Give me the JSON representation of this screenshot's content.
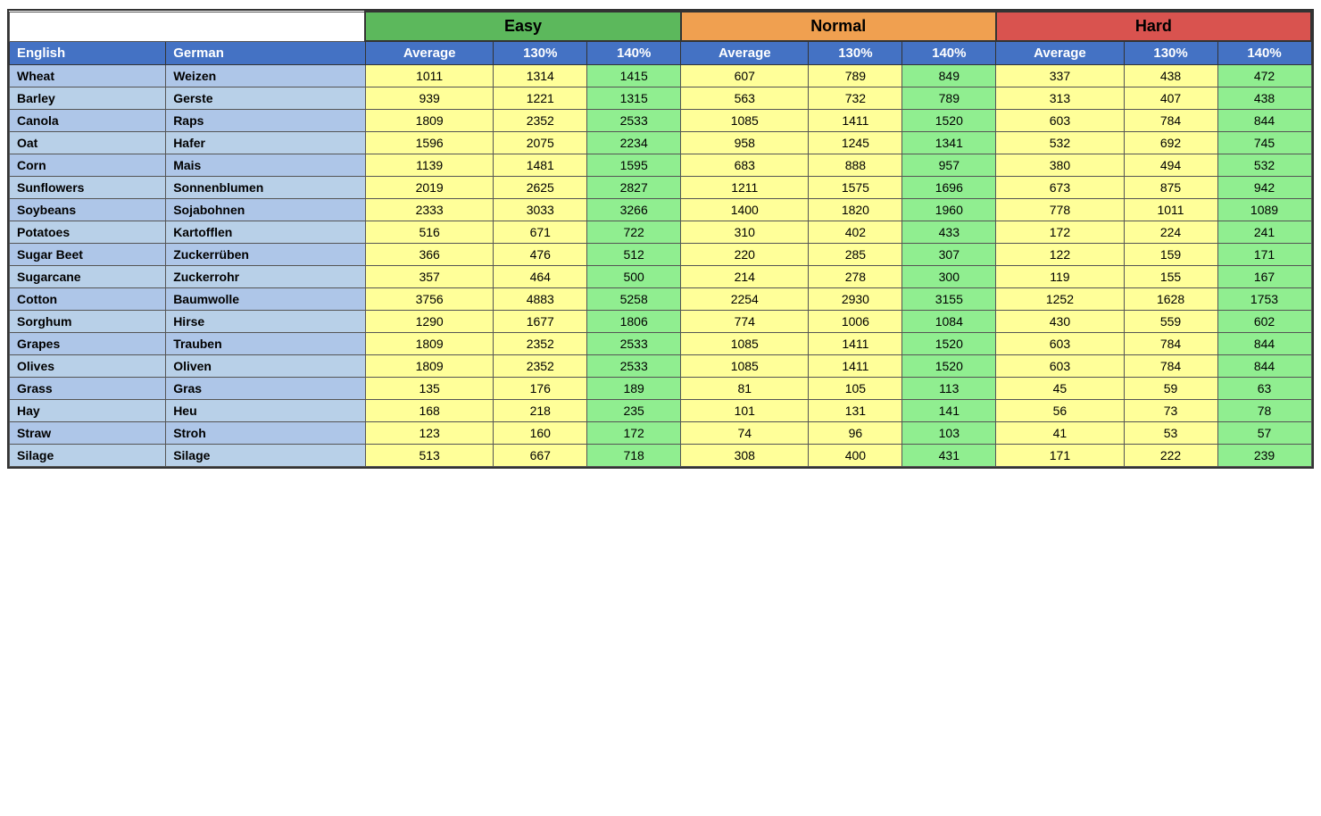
{
  "table": {
    "category_headers": {
      "easy": "Easy",
      "normal": "Normal",
      "hard": "Hard"
    },
    "col_headers": {
      "english": "English",
      "german": "German",
      "average": "Average",
      "p130": "130%",
      "p140": "140%"
    },
    "rows": [
      {
        "english": "Wheat",
        "german": "Weizen",
        "e_avg": 1011,
        "e_130": 1314,
        "e_140": 1415,
        "n_avg": 607,
        "n_130": 789,
        "n_140": 849,
        "h_avg": 337,
        "h_130": 438,
        "h_140": 472
      },
      {
        "english": "Barley",
        "german": "Gerste",
        "e_avg": 939,
        "e_130": 1221,
        "e_140": 1315,
        "n_avg": 563,
        "n_130": 732,
        "n_140": 789,
        "h_avg": 313,
        "h_130": 407,
        "h_140": 438
      },
      {
        "english": "Canola",
        "german": "Raps",
        "e_avg": 1809,
        "e_130": 2352,
        "e_140": 2533,
        "n_avg": 1085,
        "n_130": 1411,
        "n_140": 1520,
        "h_avg": 603,
        "h_130": 784,
        "h_140": 844
      },
      {
        "english": "Oat",
        "german": "Hafer",
        "e_avg": 1596,
        "e_130": 2075,
        "e_140": 2234,
        "n_avg": 958,
        "n_130": 1245,
        "n_140": 1341,
        "h_avg": 532,
        "h_130": 692,
        "h_140": 745
      },
      {
        "english": "Corn",
        "german": "Mais",
        "e_avg": 1139,
        "e_130": 1481,
        "e_140": 1595,
        "n_avg": 683,
        "n_130": 888,
        "n_140": 957,
        "h_avg": 380,
        "h_130": 494,
        "h_140": 532
      },
      {
        "english": "Sunflowers",
        "german": "Sonnenblumen",
        "e_avg": 2019,
        "e_130": 2625,
        "e_140": 2827,
        "n_avg": 1211,
        "n_130": 1575,
        "n_140": 1696,
        "h_avg": 673,
        "h_130": 875,
        "h_140": 942
      },
      {
        "english": "Soybeans",
        "german": "Sojabohnen",
        "e_avg": 2333,
        "e_130": 3033,
        "e_140": 3266,
        "n_avg": 1400,
        "n_130": 1820,
        "n_140": 1960,
        "h_avg": 778,
        "h_130": 1011,
        "h_140": 1089
      },
      {
        "english": "Potatoes",
        "german": "Kartofflen",
        "e_avg": 516,
        "e_130": 671,
        "e_140": 722,
        "n_avg": 310,
        "n_130": 402,
        "n_140": 433,
        "h_avg": 172,
        "h_130": 224,
        "h_140": 241
      },
      {
        "english": "Sugar Beet",
        "german": "Zuckerrüben",
        "e_avg": 366,
        "e_130": 476,
        "e_140": 512,
        "n_avg": 220,
        "n_130": 285,
        "n_140": 307,
        "h_avg": 122,
        "h_130": 159,
        "h_140": 171
      },
      {
        "english": "Sugarcane",
        "german": "Zuckerrohr",
        "e_avg": 357,
        "e_130": 464,
        "e_140": 500,
        "n_avg": 214,
        "n_130": 278,
        "n_140": 300,
        "h_avg": 119,
        "h_130": 155,
        "h_140": 167
      },
      {
        "english": "Cotton",
        "german": "Baumwolle",
        "e_avg": 3756,
        "e_130": 4883,
        "e_140": 5258,
        "n_avg": 2254,
        "n_130": 2930,
        "n_140": 3155,
        "h_avg": 1252,
        "h_130": 1628,
        "h_140": 1753
      },
      {
        "english": "Sorghum",
        "german": "Hirse",
        "e_avg": 1290,
        "e_130": 1677,
        "e_140": 1806,
        "n_avg": 774,
        "n_130": 1006,
        "n_140": 1084,
        "h_avg": 430,
        "h_130": 559,
        "h_140": 602
      },
      {
        "english": "Grapes",
        "german": "Trauben",
        "e_avg": 1809,
        "e_130": 2352,
        "e_140": 2533,
        "n_avg": 1085,
        "n_130": 1411,
        "n_140": 1520,
        "h_avg": 603,
        "h_130": 784,
        "h_140": 844
      },
      {
        "english": "Olives",
        "german": "Oliven",
        "e_avg": 1809,
        "e_130": 2352,
        "e_140": 2533,
        "n_avg": 1085,
        "n_130": 1411,
        "n_140": 1520,
        "h_avg": 603,
        "h_130": 784,
        "h_140": 844
      },
      {
        "english": "Grass",
        "german": "Gras",
        "e_avg": 135,
        "e_130": 176,
        "e_140": 189,
        "n_avg": 81,
        "n_130": 105,
        "n_140": 113,
        "h_avg": 45,
        "h_130": 59,
        "h_140": 63
      },
      {
        "english": "Hay",
        "german": "Heu",
        "e_avg": 168,
        "e_130": 218,
        "e_140": 235,
        "n_avg": 101,
        "n_130": 131,
        "n_140": 141,
        "h_avg": 56,
        "h_130": 73,
        "h_140": 78
      },
      {
        "english": "Straw",
        "german": "Stroh",
        "e_avg": 123,
        "e_130": 160,
        "e_140": 172,
        "n_avg": 74,
        "n_130": 96,
        "n_140": 103,
        "h_avg": 41,
        "h_130": 53,
        "h_140": 57
      },
      {
        "english": "Silage",
        "german": "Silage",
        "e_avg": 513,
        "e_130": 667,
        "e_140": 718,
        "n_avg": 308,
        "n_130": 400,
        "n_140": 431,
        "h_avg": 171,
        "h_130": 222,
        "h_140": 239
      }
    ]
  }
}
